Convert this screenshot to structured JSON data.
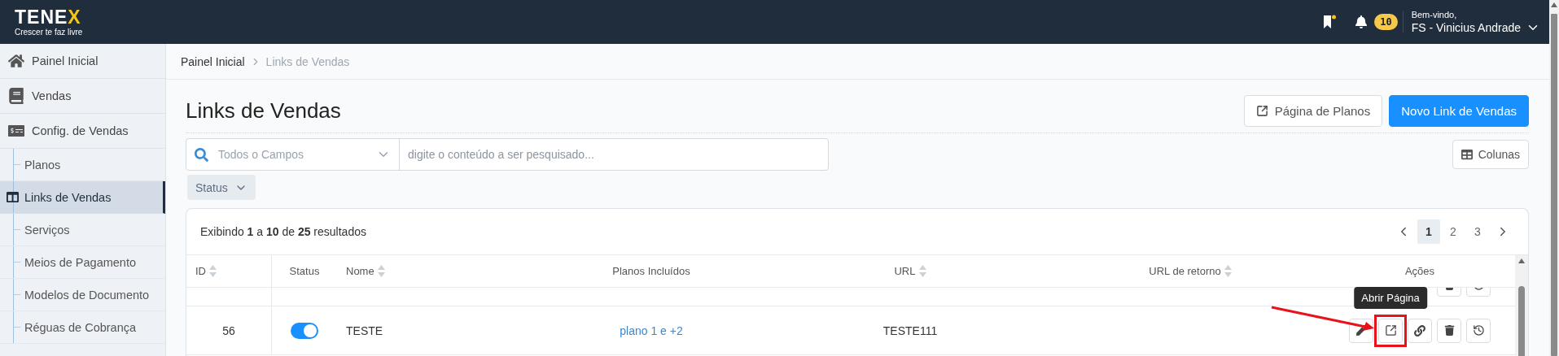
{
  "header": {
    "logo": {
      "text": "TENE",
      "accent": "X",
      "tagline": "Crescer te faz livre"
    },
    "notifications": {
      "count": "10"
    },
    "user": {
      "greeting": "Bem-vindo,",
      "name": "FS - Vinicius Andrade"
    }
  },
  "sidebar": {
    "items": [
      {
        "label": "Painel Inicial",
        "selected": false
      },
      {
        "label": "Vendas",
        "selected": false
      },
      {
        "label": "Config. de Vendas",
        "selected": false,
        "children": [
          {
            "label": "Planos",
            "selected": false
          },
          {
            "label": "Links de Vendas",
            "selected": true
          },
          {
            "label": "Serviços",
            "selected": false
          },
          {
            "label": "Meios de Pagamento",
            "selected": false
          },
          {
            "label": "Modelos de Documento",
            "selected": false
          },
          {
            "label": "Réguas de Cobrança",
            "selected": false
          }
        ]
      }
    ]
  },
  "breadcrumb": [
    {
      "label": "Painel Inicial",
      "current": false
    },
    {
      "label": "Links de Vendas",
      "current": true
    }
  ],
  "page_title": "Links de Vendas",
  "buttons": [
    {
      "label": "Página de Planos",
      "kind": "outline"
    },
    {
      "label": "Novo Link de Vendas",
      "kind": "primary"
    }
  ],
  "search": {
    "field_placeholder": "Todos o Campos",
    "placeholder": "digite o conteúdo a ser pesquisado..."
  },
  "columns_button": "Colunas",
  "filters": [
    {
      "label": "Status"
    }
  ],
  "table": {
    "summary": "Exibindo **1** a **10** de **25** resultados",
    "pages": [
      {
        "label": "1",
        "selected": true
      },
      {
        "label": "2",
        "selected": false
      },
      {
        "label": "3",
        "selected": false
      }
    ],
    "columns": [
      {
        "label": "ID",
        "sortable": true
      },
      {
        "label": "Status",
        "sortable": false
      },
      {
        "label": "Nome",
        "sortable": true
      },
      {
        "label": "Planos Incluídos",
        "sortable": false
      },
      {
        "label": "URL",
        "sortable": true
      },
      {
        "label": "URL de retorno",
        "sortable": true
      },
      {
        "label": "Ações",
        "sortable": false
      }
    ],
    "rows": [
      {
        "kind": "clipped"
      },
      {
        "kind": "full",
        "id": "56",
        "active": true,
        "name": "TESTE",
        "plans": "plano 1 e +2",
        "url": "TESTE111",
        "actions": [
          {
            "highlighted": false
          },
          {
            "highlighted": true,
            "tooltip": "Abrir Página"
          },
          {
            "highlighted": false
          },
          {
            "highlighted": false
          },
          {
            "highlighted": false
          }
        ]
      }
    ]
  }
}
